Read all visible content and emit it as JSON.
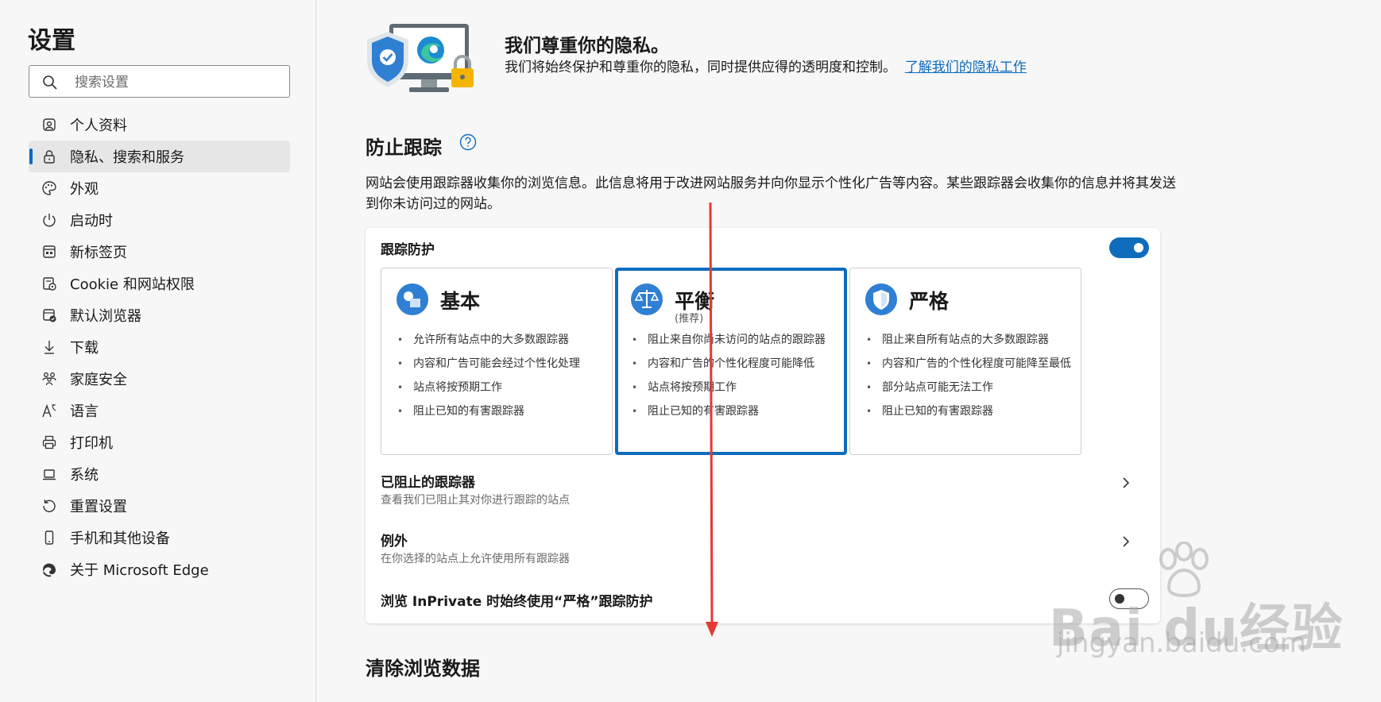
{
  "sidebar": {
    "title": "设置",
    "search_placeholder": "搜索设置",
    "items": [
      {
        "label": "个人资料",
        "icon": "profile-icon"
      },
      {
        "label": "隐私、搜索和服务",
        "icon": "lock-icon",
        "active": true
      },
      {
        "label": "外观",
        "icon": "palette-icon"
      },
      {
        "label": "启动时",
        "icon": "power-icon"
      },
      {
        "label": "新标签页",
        "icon": "new-tab-icon"
      },
      {
        "label": "Cookie 和网站权限",
        "icon": "cookie-icon"
      },
      {
        "label": "默认浏览器",
        "icon": "browser-icon"
      },
      {
        "label": "下载",
        "icon": "download-icon"
      },
      {
        "label": "家庭安全",
        "icon": "family-icon"
      },
      {
        "label": "语言",
        "icon": "language-icon"
      },
      {
        "label": "打印机",
        "icon": "printer-icon"
      },
      {
        "label": "系统",
        "icon": "laptop-icon"
      },
      {
        "label": "重置设置",
        "icon": "reset-icon"
      },
      {
        "label": "手机和其他设备",
        "icon": "phone-icon"
      },
      {
        "label": "关于 Microsoft Edge",
        "icon": "edge-icon"
      }
    ]
  },
  "hero": {
    "title": "我们尊重你的隐私。",
    "text": "我们将始终保护和尊重你的隐私，同时提供应得的透明度和控制。",
    "link": "了解我们的隐私工作"
  },
  "tracking": {
    "title": "防止跟踪",
    "description": "网站会使用跟踪器收集你的浏览信息。此信息将用于改进网站服务并向你显示个性化广告等内容。某些跟踪器会收集你的信息并将其发送到你未访问过的网站。",
    "protection_label": "跟踪防护",
    "protection_on": true,
    "levels": [
      {
        "name": "基本",
        "sub": "",
        "icon": "basic-shapes-icon",
        "selected": false,
        "items": [
          "允许所有站点中的大多数跟踪器",
          "内容和广告可能会经过个性化处理",
          "站点将按预期工作",
          "阻止已知的有害跟踪器"
        ]
      },
      {
        "name": "平衡",
        "sub": "(推荐)",
        "icon": "scales-icon",
        "selected": true,
        "items": [
          "阻止来自你尚未访问的站点的跟踪器",
          "内容和广告的个性化程度可能降低",
          "站点将按预期工作",
          "阻止已知的有害跟踪器"
        ]
      },
      {
        "name": "严格",
        "sub": "",
        "icon": "shield-icon",
        "selected": false,
        "items": [
          "阻止来自所有站点的大多数跟踪器",
          "内容和广告的个性化程度可能降至最低",
          "部分站点可能无法工作",
          "阻止已知的有害跟踪器"
        ]
      }
    ],
    "blocked": {
      "title": "已阻止的跟踪器",
      "sub": "查看我们已阻止其对你进行跟踪的站点"
    },
    "exceptions": {
      "title": "例外",
      "sub": "在你选择的站点上允许使用所有跟踪器"
    },
    "inprivate": {
      "title": "浏览 InPrivate 时始终使用“严格”跟踪防护",
      "on": false
    }
  },
  "clear_data": {
    "title": "清除浏览数据"
  },
  "watermark": {
    "main": "Bai du经验",
    "sub": "jingyan.baidu.com"
  },
  "colors": {
    "accent": "#0f6cbd",
    "arrow": "#e53935"
  }
}
